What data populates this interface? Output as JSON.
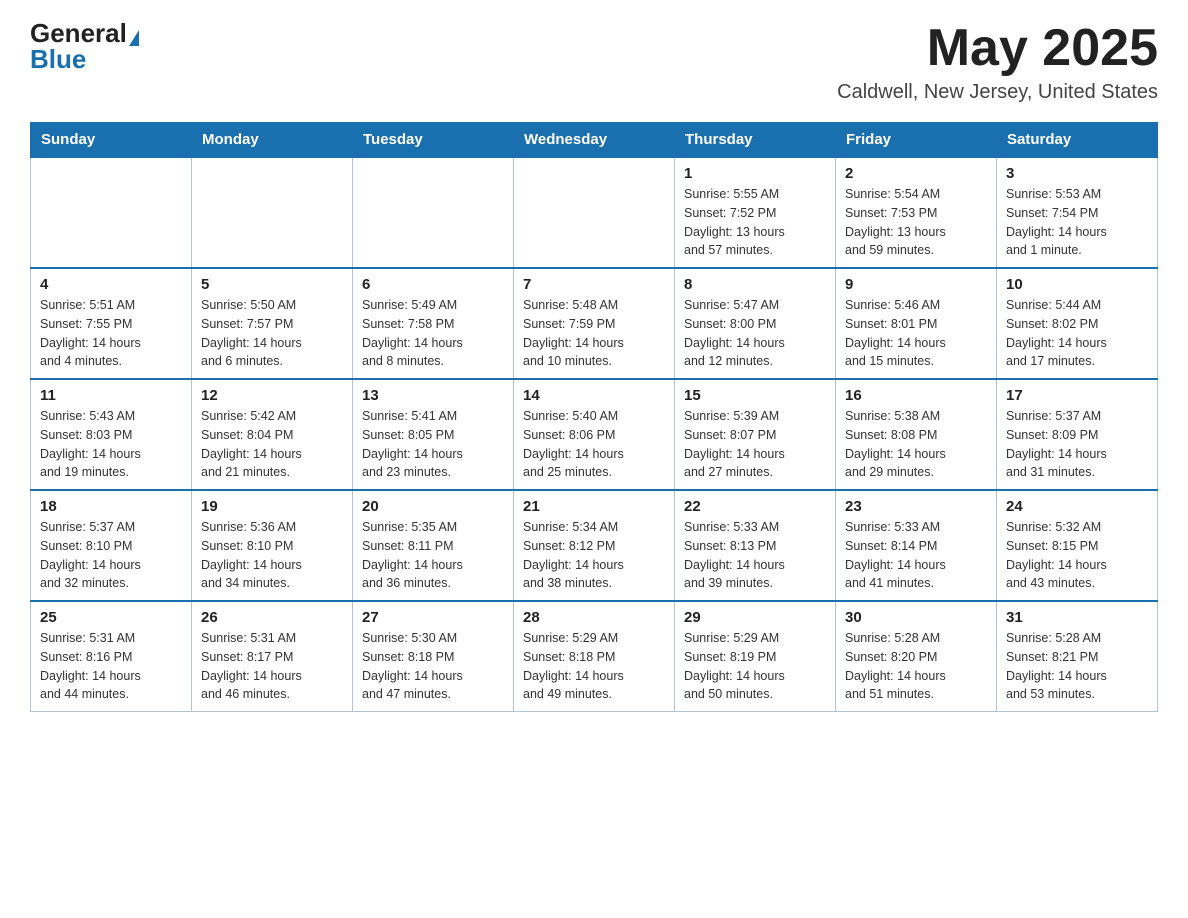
{
  "header": {
    "logo_general": "General",
    "logo_blue": "Blue",
    "title": "May 2025",
    "location": "Caldwell, New Jersey, United States"
  },
  "days_of_week": [
    "Sunday",
    "Monday",
    "Tuesday",
    "Wednesday",
    "Thursday",
    "Friday",
    "Saturday"
  ],
  "weeks": [
    [
      {
        "day": "",
        "info": ""
      },
      {
        "day": "",
        "info": ""
      },
      {
        "day": "",
        "info": ""
      },
      {
        "day": "",
        "info": ""
      },
      {
        "day": "1",
        "info": "Sunrise: 5:55 AM\nSunset: 7:52 PM\nDaylight: 13 hours\nand 57 minutes."
      },
      {
        "day": "2",
        "info": "Sunrise: 5:54 AM\nSunset: 7:53 PM\nDaylight: 13 hours\nand 59 minutes."
      },
      {
        "day": "3",
        "info": "Sunrise: 5:53 AM\nSunset: 7:54 PM\nDaylight: 14 hours\nand 1 minute."
      }
    ],
    [
      {
        "day": "4",
        "info": "Sunrise: 5:51 AM\nSunset: 7:55 PM\nDaylight: 14 hours\nand 4 minutes."
      },
      {
        "day": "5",
        "info": "Sunrise: 5:50 AM\nSunset: 7:57 PM\nDaylight: 14 hours\nand 6 minutes."
      },
      {
        "day": "6",
        "info": "Sunrise: 5:49 AM\nSunset: 7:58 PM\nDaylight: 14 hours\nand 8 minutes."
      },
      {
        "day": "7",
        "info": "Sunrise: 5:48 AM\nSunset: 7:59 PM\nDaylight: 14 hours\nand 10 minutes."
      },
      {
        "day": "8",
        "info": "Sunrise: 5:47 AM\nSunset: 8:00 PM\nDaylight: 14 hours\nand 12 minutes."
      },
      {
        "day": "9",
        "info": "Sunrise: 5:46 AM\nSunset: 8:01 PM\nDaylight: 14 hours\nand 15 minutes."
      },
      {
        "day": "10",
        "info": "Sunrise: 5:44 AM\nSunset: 8:02 PM\nDaylight: 14 hours\nand 17 minutes."
      }
    ],
    [
      {
        "day": "11",
        "info": "Sunrise: 5:43 AM\nSunset: 8:03 PM\nDaylight: 14 hours\nand 19 minutes."
      },
      {
        "day": "12",
        "info": "Sunrise: 5:42 AM\nSunset: 8:04 PM\nDaylight: 14 hours\nand 21 minutes."
      },
      {
        "day": "13",
        "info": "Sunrise: 5:41 AM\nSunset: 8:05 PM\nDaylight: 14 hours\nand 23 minutes."
      },
      {
        "day": "14",
        "info": "Sunrise: 5:40 AM\nSunset: 8:06 PM\nDaylight: 14 hours\nand 25 minutes."
      },
      {
        "day": "15",
        "info": "Sunrise: 5:39 AM\nSunset: 8:07 PM\nDaylight: 14 hours\nand 27 minutes."
      },
      {
        "day": "16",
        "info": "Sunrise: 5:38 AM\nSunset: 8:08 PM\nDaylight: 14 hours\nand 29 minutes."
      },
      {
        "day": "17",
        "info": "Sunrise: 5:37 AM\nSunset: 8:09 PM\nDaylight: 14 hours\nand 31 minutes."
      }
    ],
    [
      {
        "day": "18",
        "info": "Sunrise: 5:37 AM\nSunset: 8:10 PM\nDaylight: 14 hours\nand 32 minutes."
      },
      {
        "day": "19",
        "info": "Sunrise: 5:36 AM\nSunset: 8:10 PM\nDaylight: 14 hours\nand 34 minutes."
      },
      {
        "day": "20",
        "info": "Sunrise: 5:35 AM\nSunset: 8:11 PM\nDaylight: 14 hours\nand 36 minutes."
      },
      {
        "day": "21",
        "info": "Sunrise: 5:34 AM\nSunset: 8:12 PM\nDaylight: 14 hours\nand 38 minutes."
      },
      {
        "day": "22",
        "info": "Sunrise: 5:33 AM\nSunset: 8:13 PM\nDaylight: 14 hours\nand 39 minutes."
      },
      {
        "day": "23",
        "info": "Sunrise: 5:33 AM\nSunset: 8:14 PM\nDaylight: 14 hours\nand 41 minutes."
      },
      {
        "day": "24",
        "info": "Sunrise: 5:32 AM\nSunset: 8:15 PM\nDaylight: 14 hours\nand 43 minutes."
      }
    ],
    [
      {
        "day": "25",
        "info": "Sunrise: 5:31 AM\nSunset: 8:16 PM\nDaylight: 14 hours\nand 44 minutes."
      },
      {
        "day": "26",
        "info": "Sunrise: 5:31 AM\nSunset: 8:17 PM\nDaylight: 14 hours\nand 46 minutes."
      },
      {
        "day": "27",
        "info": "Sunrise: 5:30 AM\nSunset: 8:18 PM\nDaylight: 14 hours\nand 47 minutes."
      },
      {
        "day": "28",
        "info": "Sunrise: 5:29 AM\nSunset: 8:18 PM\nDaylight: 14 hours\nand 49 minutes."
      },
      {
        "day": "29",
        "info": "Sunrise: 5:29 AM\nSunset: 8:19 PM\nDaylight: 14 hours\nand 50 minutes."
      },
      {
        "day": "30",
        "info": "Sunrise: 5:28 AM\nSunset: 8:20 PM\nDaylight: 14 hours\nand 51 minutes."
      },
      {
        "day": "31",
        "info": "Sunrise: 5:28 AM\nSunset: 8:21 PM\nDaylight: 14 hours\nand 53 minutes."
      }
    ]
  ]
}
